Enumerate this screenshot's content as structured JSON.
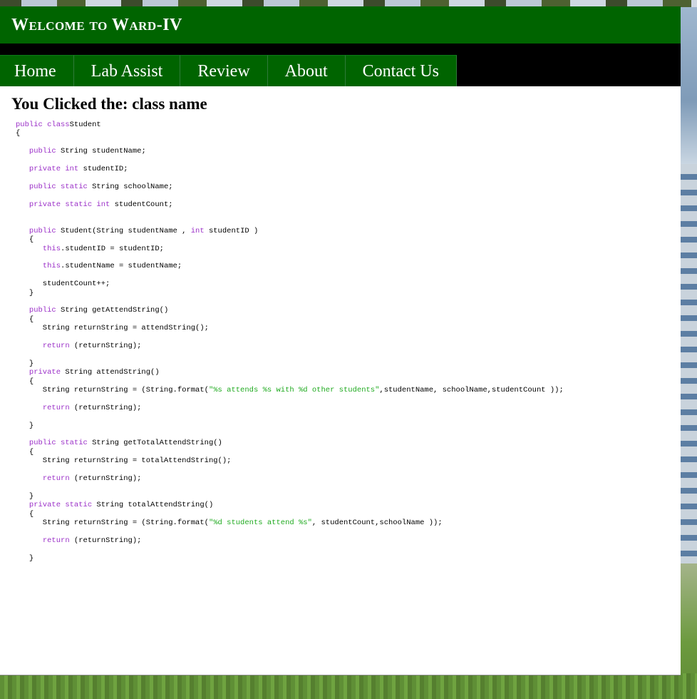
{
  "header": {
    "title": "Welcome to Ward-IV"
  },
  "nav": {
    "items": [
      "Home",
      "Lab Assist",
      "Review",
      "About",
      "Contact Us"
    ]
  },
  "main": {
    "heading": "You Clicked the: class name"
  },
  "code": {
    "lines": [
      [
        [
          "kw",
          "public class"
        ],
        [
          "",
          "Student"
        ]
      ],
      [
        [
          "",
          "{"
        ]
      ],
      [],
      [
        [
          "",
          "   "
        ],
        [
          "kw",
          "public"
        ],
        [
          "",
          " String studentName;"
        ]
      ],
      [],
      [
        [
          "",
          "   "
        ],
        [
          "kw",
          "private int"
        ],
        [
          "",
          " studentID;"
        ]
      ],
      [],
      [
        [
          "",
          "   "
        ],
        [
          "kw",
          "public static"
        ],
        [
          "",
          " String schoolName;"
        ]
      ],
      [],
      [
        [
          "",
          "   "
        ],
        [
          "kw",
          "private static int"
        ],
        [
          "",
          " studentCount;"
        ]
      ],
      [],
      [],
      [
        [
          "",
          "   "
        ],
        [
          "kw",
          "public"
        ],
        [
          "",
          " Student(String studentName , "
        ],
        [
          "kw",
          "int"
        ],
        [
          "",
          " studentID )"
        ]
      ],
      [
        [
          "",
          "   {"
        ]
      ],
      [
        [
          "",
          "      "
        ],
        [
          "kw",
          "this"
        ],
        [
          "",
          ".studentID = studentID;"
        ]
      ],
      [],
      [
        [
          "",
          "      "
        ],
        [
          "kw",
          "this"
        ],
        [
          "",
          ".studentName = studentName;"
        ]
      ],
      [],
      [
        [
          "",
          "      studentCount++;"
        ]
      ],
      [
        [
          "",
          "   }"
        ]
      ],
      [],
      [
        [
          "",
          "   "
        ],
        [
          "kw",
          "public"
        ],
        [
          "",
          " String getAttendString()"
        ]
      ],
      [
        [
          "",
          "   {"
        ]
      ],
      [
        [
          "",
          "      String returnString = attendString();"
        ]
      ],
      [],
      [
        [
          "",
          "      "
        ],
        [
          "kw",
          "return"
        ],
        [
          "",
          " (returnString);"
        ]
      ],
      [],
      [
        [
          "",
          "   }"
        ]
      ],
      [
        [
          "",
          "   "
        ],
        [
          "kw",
          "private"
        ],
        [
          "",
          " String attendString()"
        ]
      ],
      [
        [
          "",
          "   {"
        ]
      ],
      [
        [
          "",
          "      String returnString = (String.format("
        ],
        [
          "str",
          "\"%s attends %s with %d other students\""
        ],
        [
          "",
          ",studentName, schoolName,studentCount ));"
        ]
      ],
      [],
      [
        [
          "",
          "      "
        ],
        [
          "kw",
          "return"
        ],
        [
          "",
          " (returnString);"
        ]
      ],
      [],
      [
        [
          "",
          "   }"
        ]
      ],
      [],
      [
        [
          "",
          "   "
        ],
        [
          "kw",
          "public static"
        ],
        [
          "",
          " String getTotalAttendString()"
        ]
      ],
      [
        [
          "",
          "   {"
        ]
      ],
      [
        [
          "",
          "      String returnString = totalAttendString();"
        ]
      ],
      [],
      [
        [
          "",
          "      "
        ],
        [
          "kw",
          "return"
        ],
        [
          "",
          " (returnString);"
        ]
      ],
      [],
      [
        [
          "",
          "   }"
        ]
      ],
      [
        [
          "",
          "   "
        ],
        [
          "kw",
          "private static"
        ],
        [
          "",
          " String totalAttendString()"
        ]
      ],
      [
        [
          "",
          "   {"
        ]
      ],
      [
        [
          "",
          "      String returnString = (String.format("
        ],
        [
          "str",
          "\"%d students attend %s\""
        ],
        [
          "",
          ", studentCount,schoolName ));"
        ]
      ],
      [],
      [
        [
          "",
          "      "
        ],
        [
          "kw",
          "return"
        ],
        [
          "",
          " (returnString);"
        ]
      ],
      [],
      [
        [
          "",
          "   }"
        ]
      ]
    ]
  },
  "colors": {
    "header_bg": "#006400",
    "nav_bar_bg": "#000000",
    "keyword": "#9b30c8",
    "string": "#1faa1f"
  }
}
